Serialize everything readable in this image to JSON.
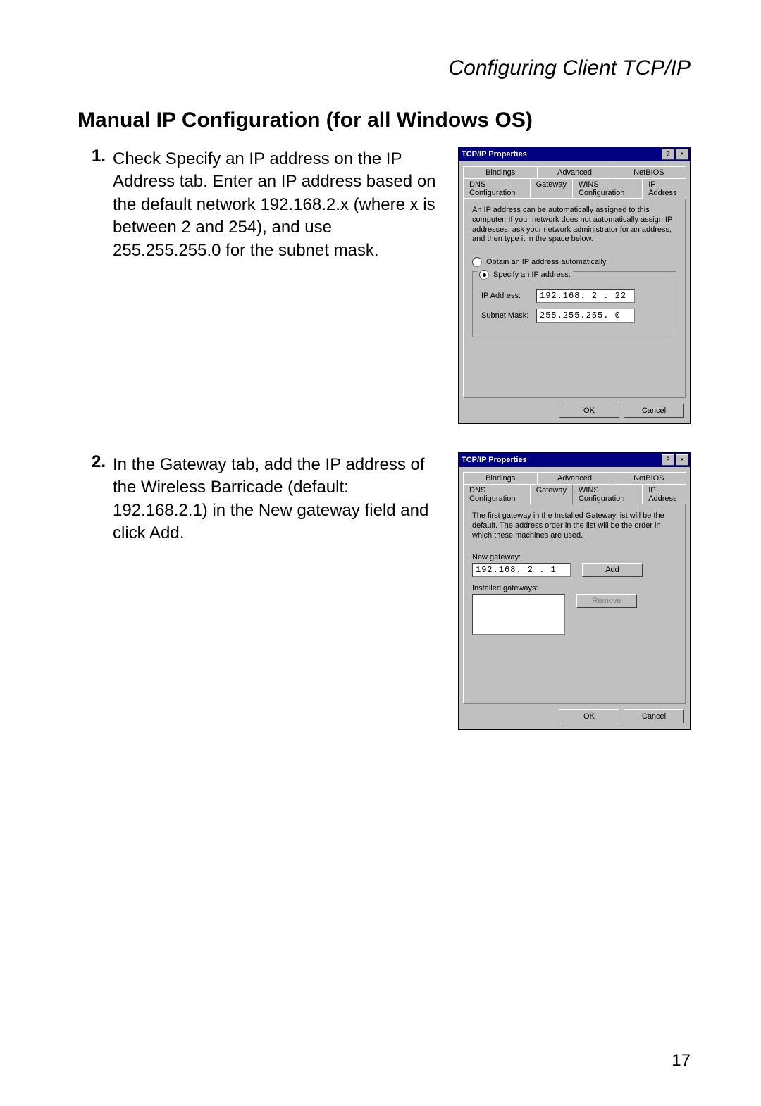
{
  "chapter_title": "Configuring Client TCP/IP",
  "section_title": "Manual IP Configuration (for all Windows OS)",
  "page_number": "17",
  "steps": [
    {
      "num": "1.",
      "text": "Check Specify an IP address on the IP Address tab. Enter an IP address based on the default network 192.168.2.x (where x is between 2 and 254), and use 255.255.255.0 for the subnet mask."
    },
    {
      "num": "2.",
      "text": "In the Gateway tab, add the IP address of the Wireless Barricade (default: 192.168.2.1) in the New gateway field and click Add."
    }
  ],
  "dialog1": {
    "title": "TCP/IP Properties",
    "help_btn": "?",
    "close_btn": "×",
    "tabs_row1": [
      "Bindings",
      "Advanced",
      "NetBIOS"
    ],
    "tabs_row2": [
      "DNS Configuration",
      "Gateway",
      "WINS Configuration",
      "IP Address"
    ],
    "active_tab": "IP Address",
    "description": "An IP address can be automatically assigned to this computer. If your network does not automatically assign IP addresses, ask your network administrator for an address, and then type it in the space below.",
    "radio_auto": "Obtain an IP address automatically",
    "radio_manual": "Specify an IP address:",
    "ip_label": "IP Address:",
    "ip_value": "192.168. 2 . 22",
    "mask_label": "Subnet Mask:",
    "mask_value": "255.255.255. 0",
    "ok": "OK",
    "cancel": "Cancel"
  },
  "dialog2": {
    "title": "TCP/IP Properties",
    "help_btn": "?",
    "close_btn": "×",
    "tabs_row1": [
      "Bindings",
      "Advanced",
      "NetBIOS"
    ],
    "tabs_row2": [
      "DNS Configuration",
      "Gateway",
      "WINS Configuration",
      "IP Address"
    ],
    "active_tab": "Gateway",
    "description": "The first gateway in the Installed Gateway list will be the default. The address order in the list will be the order in which these machines are used.",
    "new_gw_label": "New gateway:",
    "new_gw_value": "192.168. 2 . 1",
    "add_btn": "Add",
    "installed_label": "Installed gateways:",
    "remove_btn": "Remove",
    "ok": "OK",
    "cancel": "Cancel"
  }
}
